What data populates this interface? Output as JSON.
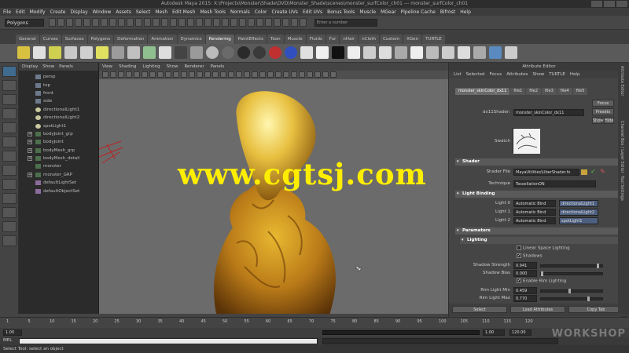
{
  "window": {
    "title": "Autodesk Maya 2015: X:\\Projects\\Monster\\Shade\\DVD\\Monster_Shade\\scenes\\monster_surfColor_ch01 --- monster_surfColor_ch01"
  },
  "menubar": [
    "File",
    "Edit",
    "Modify",
    "Create",
    "Display",
    "Window",
    "Assets",
    "Select",
    "Mesh",
    "Edit Mesh",
    "Mesh Tools",
    "Normals",
    "Color",
    "Create UVs",
    "Edit UVs",
    "Bonus Tools",
    "Muscle",
    "MGear",
    "Pipeline Cache",
    "Bifrost",
    "Help"
  ],
  "statusline": {
    "mode": "Polygons",
    "search_placeholder": "Enter a number"
  },
  "shelf_tabs": [
    {
      "label": "General",
      "active": false
    },
    {
      "label": "Curves",
      "active": false
    },
    {
      "label": "Surfaces",
      "active": false
    },
    {
      "label": "Polygons",
      "active": false
    },
    {
      "label": "Deformation",
      "active": false
    },
    {
      "label": "Animation",
      "active": false
    },
    {
      "label": "Dynamics",
      "active": false
    },
    {
      "label": "Rendering",
      "active": true
    },
    {
      "label": "PaintEffects",
      "active": false
    },
    {
      "label": "Toon",
      "active": false
    },
    {
      "label": "Muscle",
      "active": false
    },
    {
      "label": "Fluids",
      "active": false
    },
    {
      "label": "Fur",
      "active": false
    },
    {
      "label": "nHair",
      "active": false
    },
    {
      "label": "nCloth",
      "active": false
    },
    {
      "label": "Custom",
      "active": false
    },
    {
      "label": "XGen",
      "active": false
    },
    {
      "label": "TURTLE",
      "active": false
    }
  ],
  "outliner": {
    "menu": [
      "Display",
      "Show",
      "Panels"
    ],
    "items": [
      {
        "label": "persp",
        "type": "cam",
        "expandable": false
      },
      {
        "label": "top",
        "type": "cam",
        "expandable": false
      },
      {
        "label": "front",
        "type": "cam",
        "expandable": false
      },
      {
        "label": "side",
        "type": "cam",
        "expandable": false
      },
      {
        "label": "directionalLight1",
        "type": "light",
        "expandable": false
      },
      {
        "label": "directionalLight2",
        "type": "light",
        "expandable": false
      },
      {
        "label": "spotLight1",
        "type": "light",
        "expandable": false
      },
      {
        "label": "bodyJoint_grp",
        "type": "mesh",
        "expandable": true
      },
      {
        "label": "bodyJoint",
        "type": "mesh",
        "expandable": true
      },
      {
        "label": "bodyMesh_grp",
        "type": "mesh",
        "expandable": true
      },
      {
        "label": "bodyMesh_detail",
        "type": "mesh",
        "expandable": true
      },
      {
        "label": "monster",
        "type": "mesh",
        "expandable": false
      },
      {
        "label": "monster_GRP",
        "type": "mesh",
        "expandable": true
      },
      {
        "label": "defaultLightSet",
        "type": "set",
        "expandable": false
      },
      {
        "label": "defaultObjectSet",
        "type": "set",
        "expandable": false
      }
    ]
  },
  "viewport": {
    "menu": [
      "View",
      "Shading",
      "Lighting",
      "Show",
      "Renderer",
      "Panels"
    ],
    "watermark": "www.cgtsj.com"
  },
  "attribute_editor": {
    "title": "Attribute Editor",
    "menu": [
      "List",
      "Selected",
      "Focus",
      "Attributes",
      "Show",
      "TURTLE",
      "Help"
    ],
    "node_tabs": [
      {
        "label": "monster_skinColor_dx11",
        "active": true
      },
      {
        "label": "file1",
        "active": false
      },
      {
        "label": "file2",
        "active": false
      },
      {
        "label": "file3",
        "active": false
      },
      {
        "label": "file4",
        "active": false
      },
      {
        "label": "file5",
        "active": false
      }
    ],
    "node_label": "dx11Shader:",
    "node_name": "monster_skinColor_dx11",
    "buttons": {
      "focus": "Focus",
      "presets": "Presets",
      "show": "Show",
      "hide": "Hide"
    },
    "swatch_label": "Swatch",
    "sections": {
      "shader": "Shader",
      "light_binding": "Light Binding",
      "parameters": "Parameters",
      "lighting": "Lighting"
    },
    "shader_file_label": "Shader File",
    "shader_file_value": "MayaUtilities\\UberShader.fx",
    "technique_label": "Technique",
    "technique_value": "TessellationON",
    "lights": [
      {
        "label": "Light 0",
        "mode": "Automatic Bind",
        "target": "directionalLight1"
      },
      {
        "label": "Light 1",
        "mode": "Automatic Bind",
        "target": "directionalLight2"
      },
      {
        "label": "Light 2",
        "mode": "Automatic Bind",
        "target": "spotLight1"
      }
    ],
    "checks": [
      {
        "label": "Linear Space Lighting",
        "checked": false
      },
      {
        "label": "Shadows",
        "checked": true
      },
      {
        "label": "Enable Rim Lighting",
        "checked": true
      }
    ],
    "params": [
      {
        "label": "Shadow Strength",
        "value": "0.941",
        "fraction": 0.94
      },
      {
        "label": "Shadow Bias",
        "value": "0.000",
        "fraction": 0.0
      },
      {
        "label": "Rim Light Min",
        "value": "0.459",
        "fraction": 0.46
      },
      {
        "label": "Rim Light Max",
        "value": "0.770",
        "fraction": 0.77
      }
    ],
    "bottom_buttons": [
      "Select",
      "Load Attributes",
      "Copy Tab"
    ]
  },
  "channel_strip": [
    "Attribute Editor",
    "Channel Box / Layer Editor",
    "Tool Settings"
  ],
  "timeslider": {
    "ticks": [
      "1",
      "5",
      "10",
      "15",
      "20",
      "25",
      "30",
      "35",
      "40",
      "45",
      "50",
      "55",
      "60",
      "65",
      "70",
      "75",
      "80",
      "85",
      "90",
      "95",
      "100",
      "105",
      "110",
      "115",
      "120"
    ],
    "start": "1.00",
    "end": "120.00",
    "current": "1.00"
  },
  "cmdline": {
    "label": "MEL"
  },
  "helpline": {
    "text": "Select Tool: select an object"
  },
  "logo": "WORKSHOP",
  "colors": {
    "accent": "#3f6b8f",
    "watermark": "#ffee00",
    "model_gold": "#d9a520"
  }
}
